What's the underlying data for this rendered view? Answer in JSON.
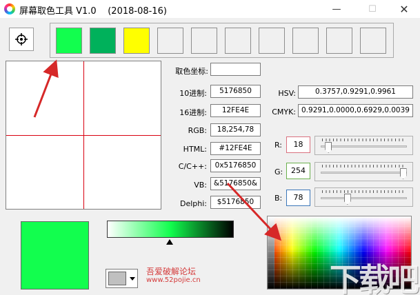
{
  "window": {
    "title": "屏幕取色工具 V1.0    (2018-08-16)",
    "min_glyph": "—",
    "max_glyph": "☐",
    "close_glyph": "✕"
  },
  "swatches": [
    "#12fe4e",
    "#00b15b",
    "#ffff00",
    "#f0f0f0",
    "#f0f0f0",
    "#f0f0f0",
    "#f0f0f0",
    "#f0f0f0",
    "#f0f0f0",
    "#f0f0f0"
  ],
  "fields": {
    "coord_label": "取色坐标:",
    "coord_value": "",
    "dec_label": "10进制:",
    "dec_value": "5176850",
    "hex_label": "16进制:",
    "hex_value": "12FE4E",
    "rgb_label": "RGB:",
    "rgb_value": "18,254,78",
    "html_label": "HTML:",
    "html_value": "#12FE4E",
    "cpp_label": "C/C++:",
    "cpp_value": "0x5176850",
    "vb_label": "VB:",
    "vb_value": "&5176850&",
    "delphi_label": "Delphi:",
    "delphi_value": "$5176850",
    "hsv_label": "HSV:",
    "hsv_value": "0.3757,0.9291,0.9961",
    "cmyk_label": "CMYK:",
    "cmyk_value": "0.9291,0.0000,0.6929,0.0039"
  },
  "sliders": {
    "r_label": "R:",
    "r_value": "18",
    "g_label": "G:",
    "g_value": "254",
    "b_label": "B:",
    "b_value": "78",
    "r_level": 18,
    "g_level": 254,
    "b_level": 78,
    "max": 255,
    "r_border": "#d9707e",
    "g_border": "#6ab04c",
    "b_border": "#3a76b8"
  },
  "preview": {
    "color": "#12fe4e",
    "gradient_start": "#ffffff",
    "gradient_mid": "#12fe4e",
    "gradient_end": "#000000"
  },
  "watermark": {
    "line1": "吾爱破解论坛",
    "line2": "www.52pojie.cn"
  },
  "corner_logo": "下载吧"
}
